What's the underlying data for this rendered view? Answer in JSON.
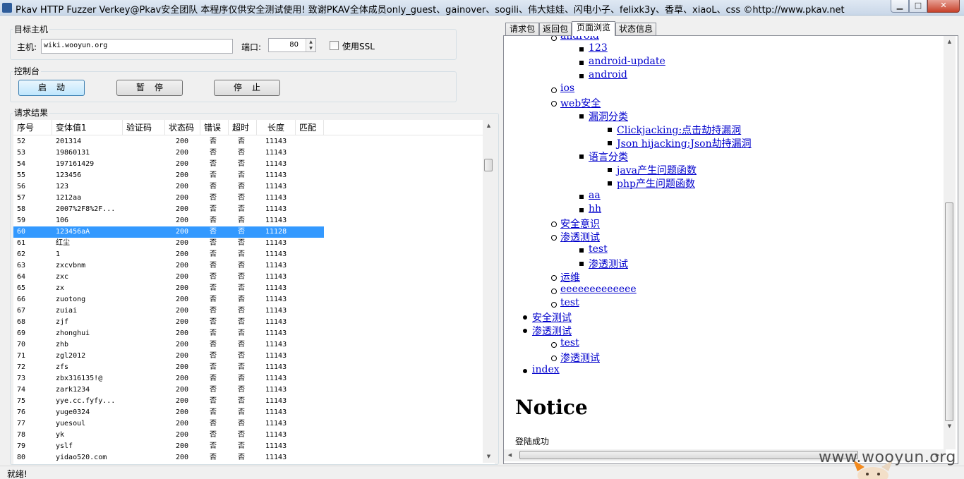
{
  "window": {
    "title": "Pkav HTTP Fuzzer   Verkey@Pkav安全团队  本程序仅供安全测试使用!  致谢PKAV全体成员only_guest、gainover、sogili、伟大娃娃、闪电小子、felixk3y、香草、xiaoL、css  ©http://www.pkav.net",
    "min_label": "▁",
    "max_label": "□",
    "close_label": "✕"
  },
  "target": {
    "group_title": "目标主机",
    "host_label": "主机:",
    "host_value": "wiki.wooyun.org",
    "port_label": "端口:",
    "port_value": "80",
    "ssl_label": "使用SSL",
    "ssl_checked": false
  },
  "console": {
    "group_title": "控制台",
    "start_label": "启动",
    "pause_label": "暂停",
    "stop_label": "停止"
  },
  "results": {
    "group_title": "请求结果",
    "columns": [
      "序号",
      "变体值1",
      "验证码",
      "状态码",
      "错误",
      "超时",
      "长度",
      "匹配"
    ],
    "rows": [
      {
        "idx": "52",
        "var": "201314",
        "status": "200",
        "err": "否",
        "timeout": "否",
        "len": "11143"
      },
      {
        "idx": "53",
        "var": "19860131",
        "status": "200",
        "err": "否",
        "timeout": "否",
        "len": "11143"
      },
      {
        "idx": "54",
        "var": "197161429",
        "status": "200",
        "err": "否",
        "timeout": "否",
        "len": "11143"
      },
      {
        "idx": "55",
        "var": "123456",
        "status": "200",
        "err": "否",
        "timeout": "否",
        "len": "11143"
      },
      {
        "idx": "56",
        "var": "123",
        "status": "200",
        "err": "否",
        "timeout": "否",
        "len": "11143"
      },
      {
        "idx": "57",
        "var": "1212aa",
        "status": "200",
        "err": "否",
        "timeout": "否",
        "len": "11143"
      },
      {
        "idx": "58",
        "var": "2007%2F8%2F...",
        "status": "200",
        "err": "否",
        "timeout": "否",
        "len": "11143"
      },
      {
        "idx": "59",
        "var": "106",
        "status": "200",
        "err": "否",
        "timeout": "否",
        "len": "11143"
      },
      {
        "idx": "60",
        "var": "123456aA",
        "status": "200",
        "err": "否",
        "timeout": "否",
        "len": "11128",
        "selected": true
      },
      {
        "idx": "61",
        "var": "红尘",
        "status": "200",
        "err": "否",
        "timeout": "否",
        "len": "11143"
      },
      {
        "idx": "62",
        "var": "1",
        "status": "200",
        "err": "否",
        "timeout": "否",
        "len": "11143"
      },
      {
        "idx": "63",
        "var": "zxcvbnm",
        "status": "200",
        "err": "否",
        "timeout": "否",
        "len": "11143"
      },
      {
        "idx": "64",
        "var": "zxc",
        "status": "200",
        "err": "否",
        "timeout": "否",
        "len": "11143"
      },
      {
        "idx": "65",
        "var": "zx",
        "status": "200",
        "err": "否",
        "timeout": "否",
        "len": "11143"
      },
      {
        "idx": "66",
        "var": "zuotong",
        "status": "200",
        "err": "否",
        "timeout": "否",
        "len": "11143"
      },
      {
        "idx": "67",
        "var": "zuiai",
        "status": "200",
        "err": "否",
        "timeout": "否",
        "len": "11143"
      },
      {
        "idx": "68",
        "var": "zjf",
        "status": "200",
        "err": "否",
        "timeout": "否",
        "len": "11143"
      },
      {
        "idx": "69",
        "var": "zhonghui",
        "status": "200",
        "err": "否",
        "timeout": "否",
        "len": "11143"
      },
      {
        "idx": "70",
        "var": "zhb",
        "status": "200",
        "err": "否",
        "timeout": "否",
        "len": "11143"
      },
      {
        "idx": "71",
        "var": "zgl2012",
        "status": "200",
        "err": "否",
        "timeout": "否",
        "len": "11143"
      },
      {
        "idx": "72",
        "var": "zfs",
        "status": "200",
        "err": "否",
        "timeout": "否",
        "len": "11143"
      },
      {
        "idx": "73",
        "var": "zbx316135!@",
        "status": "200",
        "err": "否",
        "timeout": "否",
        "len": "11143"
      },
      {
        "idx": "74",
        "var": "zark1234",
        "status": "200",
        "err": "否",
        "timeout": "否",
        "len": "11143"
      },
      {
        "idx": "75",
        "var": "yye.cc.fyfy...",
        "status": "200",
        "err": "否",
        "timeout": "否",
        "len": "11143"
      },
      {
        "idx": "76",
        "var": "yuge0324",
        "status": "200",
        "err": "否",
        "timeout": "否",
        "len": "11143"
      },
      {
        "idx": "77",
        "var": "yuesoul",
        "status": "200",
        "err": "否",
        "timeout": "否",
        "len": "11143"
      },
      {
        "idx": "78",
        "var": "yk",
        "status": "200",
        "err": "否",
        "timeout": "否",
        "len": "11143"
      },
      {
        "idx": "79",
        "var": "yslf",
        "status": "200",
        "err": "否",
        "timeout": "否",
        "len": "11143"
      },
      {
        "idx": "80",
        "var": "yidao520.com",
        "status": "200",
        "err": "否",
        "timeout": "否",
        "len": "11143"
      }
    ]
  },
  "right": {
    "tabs": [
      "请求包",
      "返回包",
      "页面浏览",
      "状态信息"
    ],
    "active_tab": 2,
    "tree": [
      {
        "text": "android",
        "level": 2
      },
      {
        "text": "123",
        "level": 3
      },
      {
        "text": "android-update",
        "level": 3
      },
      {
        "text": "android",
        "level": 3
      },
      {
        "text": "ios",
        "level": 2
      },
      {
        "text": "web安全",
        "level": 2
      },
      {
        "text": "漏洞分类",
        "level": 3
      },
      {
        "text": "Clickjacking:点击劫持漏洞",
        "level": 4
      },
      {
        "text": "Json hijacking:Json劫持漏洞",
        "level": 4
      },
      {
        "text": "语言分类",
        "level": 3
      },
      {
        "text": "java产生问题函数",
        "level": 4
      },
      {
        "text": "php产生问题函数",
        "level": 4
      },
      {
        "text": "aa",
        "level": 3
      },
      {
        "text": "hh",
        "level": 3
      },
      {
        "text": "安全意识",
        "level": 2
      },
      {
        "text": "渗透测试",
        "level": 2
      },
      {
        "text": "test",
        "level": 3
      },
      {
        "text": "渗透测试",
        "level": 3
      },
      {
        "text": "运维",
        "level": 2
      },
      {
        "text": "eeeeeeeeeeeee",
        "level": 2
      },
      {
        "text": "test",
        "level": 2
      },
      {
        "text": "安全测试",
        "level": 1
      },
      {
        "text": "渗透测试",
        "level": 1
      },
      {
        "text": "test",
        "level": 2
      },
      {
        "text": "渗透测试",
        "level": 2
      },
      {
        "text": "index",
        "level": 1
      }
    ],
    "notice_heading": "Notice",
    "login_text": "登陆成功",
    "link_color": "#0000cc"
  },
  "status": {
    "text": "就绪!"
  },
  "watermark": "www.wooyun.org",
  "colors": {
    "selection": "#3399ff",
    "close_button": "#c7412a"
  }
}
